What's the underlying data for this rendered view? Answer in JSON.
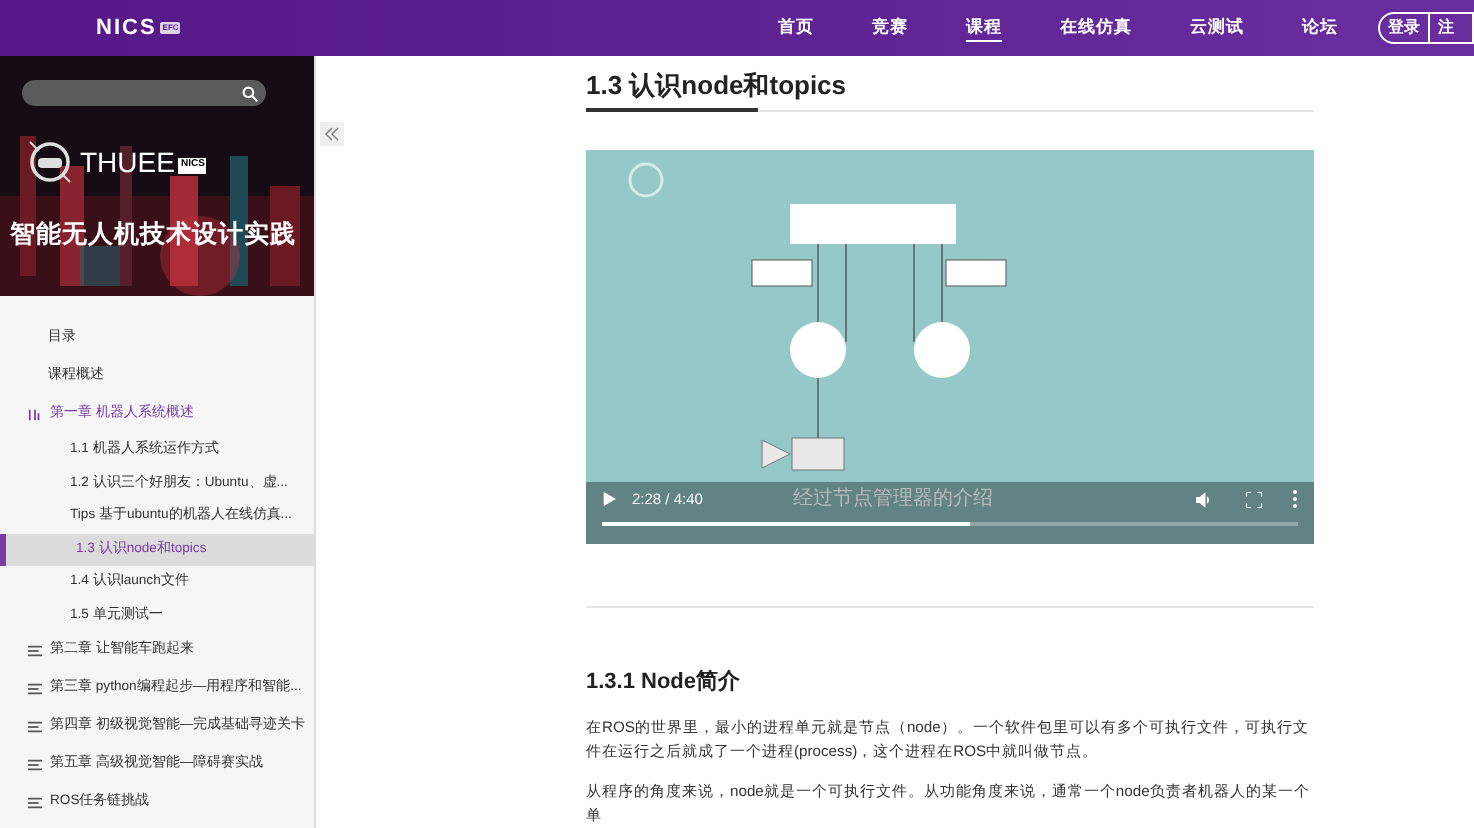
{
  "nav": {
    "logo": "NICS",
    "logo_badge": "EFC",
    "items": [
      {
        "label": "首页",
        "selected": false
      },
      {
        "label": "竞赛",
        "selected": false
      },
      {
        "label": "课程",
        "selected": true
      },
      {
        "label": "在线仿真",
        "selected": false
      },
      {
        "label": "云测试",
        "selected": false
      },
      {
        "label": "论坛",
        "selected": false
      }
    ],
    "buttons": [
      "登录",
      "注"
    ]
  },
  "sidebar": {
    "banner": {
      "brand": "THUEE",
      "brand_badge": "NICS",
      "title": "智能无人机技术设计实践"
    },
    "items": [
      {
        "kind": "page",
        "label": "目录",
        "selected": false
      },
      {
        "kind": "page",
        "label": "课程概述",
        "selected": false
      },
      {
        "kind": "chapter",
        "label": "第一章 机器人系统概述",
        "expanded": true,
        "selected": false,
        "children": [
          {
            "label": "1.1 机器人系统运作方式",
            "selected": false
          },
          {
            "label": "1.2 认识三个好朋友：Ubuntu、虚...",
            "selected": false
          },
          {
            "label": "Tips 基于ubuntu的机器人在线仿真...",
            "selected": false
          },
          {
            "label": "1.3 认识node和topics",
            "selected": true
          },
          {
            "label": "1.4 认识launch文件",
            "selected": false
          },
          {
            "label": "1.5 单元测试一",
            "selected": false
          }
        ]
      },
      {
        "kind": "chapter",
        "label": "第二章 让智能车跑起来",
        "expanded": false,
        "selected": false
      },
      {
        "kind": "chapter",
        "label": "第三章 python编程起步—用程序和智能...",
        "expanded": false,
        "selected": false
      },
      {
        "kind": "chapter",
        "label": "第四章 初级视觉智能—完成基础寻迹关卡",
        "expanded": false,
        "selected": false
      },
      {
        "kind": "chapter",
        "label": "第五章 高级视觉智能—障碍赛实战",
        "expanded": false,
        "selected": false
      },
      {
        "kind": "chapter",
        "label": "ROS任务链挑战",
        "expanded": false,
        "selected": false
      }
    ]
  },
  "article": {
    "title": "1.3 认识node和topics",
    "video": {
      "time": "2:28 / 4:40",
      "subtitle": "经过节点管理器的介绍",
      "level": 0.53
    },
    "section": "1.3.1 Node简介",
    "paragraphs": [
      "在ROS的世界里，最小的进程单元就是节点（node）。一个软件包里可以有多个可执行文件，可执行文件在运行之后就成了一个进程(process)，这个进程在ROS中就叫做节点。",
      "从程序的角度来说，node就是一个可执行文件。从功能角度来说，通常一个node负责者机器人的某一个单"
    ]
  }
}
